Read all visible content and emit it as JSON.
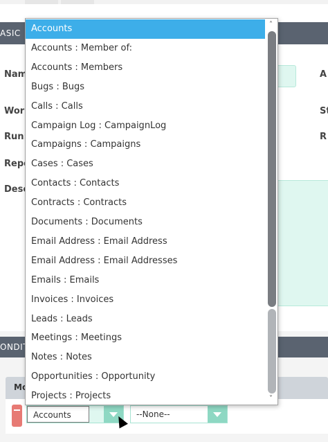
{
  "form": {
    "basic_header": "ASIC",
    "labels": {
      "name": "Nam",
      "workflow": "Work",
      "run": "Run:",
      "repeat": "Repe",
      "description": "Desc",
      "right_a": "A",
      "right_s": "St",
      "right_r": "R"
    },
    "conditions_header": "ONDIT",
    "module_tab": "Mo"
  },
  "condition_row": {
    "module_select": "Accounts",
    "operator_select": "--None--"
  },
  "dropdown": {
    "selected_index": 0,
    "items": [
      "Accounts",
      "Accounts : Member of:",
      "Accounts : Members",
      "Bugs : Bugs",
      "Calls : Calls",
      "Campaign Log : CampaignLog",
      "Campaigns : Campaigns",
      "Cases : Cases",
      "Contacts : Contacts",
      "Contracts : Contracts",
      "Documents : Documents",
      "Email Address : Email Address",
      "Email Address : Email Addresses",
      "Emails : Emails",
      "Invoices : Invoices",
      "Leads : Leads",
      "Meetings : Meetings",
      "Notes : Notes",
      "Opportunities : Opportunity",
      "Projects : Projects"
    ],
    "scroll_up": "˄",
    "scroll_down": "˅"
  },
  "colors": {
    "header_band": "#5a6370",
    "selection": "#3daee9",
    "mint": "#dff7f0",
    "select_arrow": "#8ed8c3",
    "remove": "#e77a74"
  }
}
